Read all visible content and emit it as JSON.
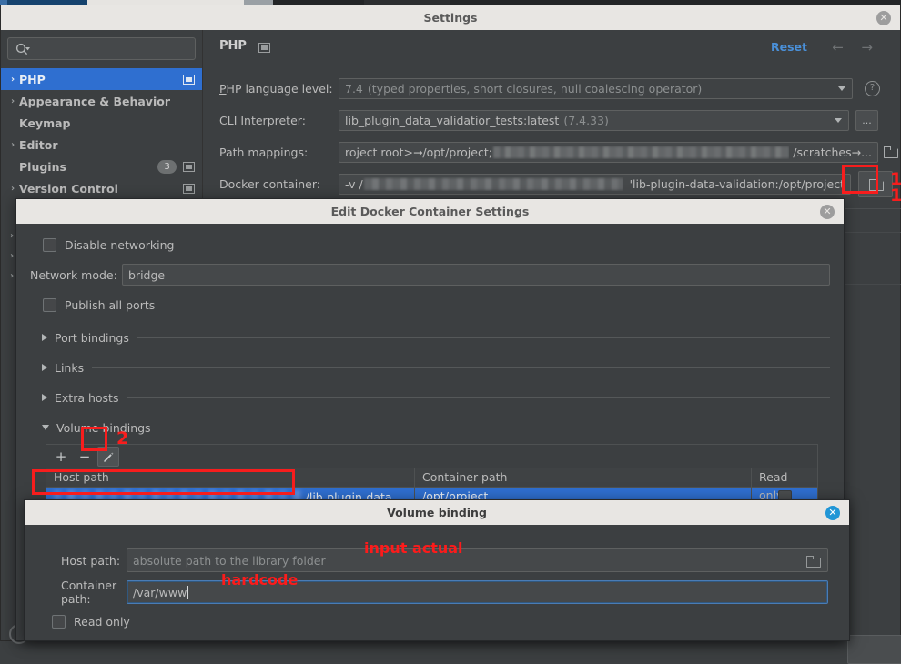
{
  "colors": {
    "accent_blue": "#2f6fd0",
    "link_blue": "#4a90d9",
    "annotation_red": "#f71d1d",
    "window_bg": "#3c3f41",
    "titlebar_bg": "#e8e6e3",
    "close_active_blue": "#2196d6"
  },
  "settings_window": {
    "title": "Settings",
    "close_icon": "close-icon",
    "search": {
      "placeholder": "",
      "value": "",
      "icon": "search-icon",
      "dropdown_icon": "chevron-down-icon"
    },
    "sidebar": {
      "items": [
        {
          "label": "PHP",
          "chevron": "›",
          "selected": true,
          "has_marker": true,
          "badge": null
        },
        {
          "label": "Appearance & Behavior",
          "chevron": "›",
          "selected": false,
          "has_marker": false,
          "badge": null
        },
        {
          "label": "Keymap",
          "chevron": "",
          "selected": false,
          "has_marker": false,
          "badge": null
        },
        {
          "label": "Editor",
          "chevron": "›",
          "selected": false,
          "has_marker": false,
          "badge": null
        },
        {
          "label": "Plugins",
          "chevron": "",
          "selected": false,
          "has_marker": true,
          "badge": "3"
        },
        {
          "label": "Version Control",
          "chevron": "›",
          "selected": false,
          "has_marker": true,
          "badge": null
        }
      ],
      "hidden_chevrons": [
        "›",
        "›",
        "›"
      ]
    },
    "content": {
      "page_title": "PHP",
      "page_title_marker_icon": "panel-marker-icon",
      "reset_label": "Reset",
      "back_icon": "←",
      "forward_icon": "→",
      "fields": {
        "php_language_level": {
          "label": "PHP language level:",
          "label_mnemonic": "P",
          "value": "7.4",
          "value_hint": "(typed properties, short closures, null coalescing operator)",
          "dropdown_icon": "chevron-down-icon",
          "help_icon": "help-icon"
        },
        "cli_interpreter": {
          "label": "CLI Interpreter:",
          "value": "lib_plugin_data_validatior_tests:latest",
          "value_hint": "(7.4.33)",
          "dropdown_icon": "chevron-down-icon",
          "browse_label": "..."
        },
        "path_mappings": {
          "label": "Path mappings:",
          "value_start": "roject root>→/opt/project;",
          "value_redacted": true,
          "value_end": "/scratches→...",
          "browse_icon": "folder-icon"
        },
        "docker_container": {
          "label": "Docker container:",
          "value_start": "-v /",
          "value_redacted": true,
          "value_end": "'lib-plugin-data-validation:/opt/project",
          "browse_icon": "folder-icon"
        }
      }
    }
  },
  "docker_dialog": {
    "title": "Edit Docker Container Settings",
    "close_icon": "close-icon",
    "disable_networking": {
      "label": "Disable networking",
      "checked": false
    },
    "network_mode": {
      "label": "Network mode:",
      "value": "bridge"
    },
    "publish_all_ports": {
      "label": "Publish all ports",
      "checked": false
    },
    "sections": [
      {
        "label": "Port bindings",
        "expanded": false
      },
      {
        "label": "Links",
        "expanded": false
      },
      {
        "label": "Extra hosts",
        "expanded": false
      },
      {
        "label": "Volume bindings",
        "expanded": true
      }
    ],
    "volume_bindings": {
      "toolbar": {
        "add_label": "+",
        "remove_label": "−",
        "edit_icon": "pencil-icon",
        "edit_pressed": true
      },
      "columns": [
        "Host path",
        "Container path",
        "Read-only"
      ],
      "rows": [
        {
          "host_path": "",
          "host_path_redacted": true,
          "host_path_suffix": "/lib-plugin-data-...",
          "container_path": "/opt/project",
          "read_only": false,
          "selected": true
        }
      ]
    }
  },
  "volume_binding_dialog": {
    "title": "Volume binding",
    "close_icon": "close-icon",
    "host_path": {
      "label": "Host path:",
      "value": "",
      "placeholder": "absolute path to the library folder",
      "browse_icon": "folder-icon"
    },
    "container_path": {
      "label": "Container path:",
      "value": "/var/www",
      "focused": true
    },
    "read_only": {
      "label": "Read only",
      "checked": false
    }
  },
  "annotations": [
    {
      "name": "marker-1a",
      "text": "1"
    },
    {
      "name": "marker-1b",
      "text": "1"
    },
    {
      "name": "marker-2",
      "text": "2"
    },
    {
      "name": "note-input-actual",
      "text": "input actual"
    },
    {
      "name": "note-hardcode",
      "text": "hardcode"
    }
  ]
}
